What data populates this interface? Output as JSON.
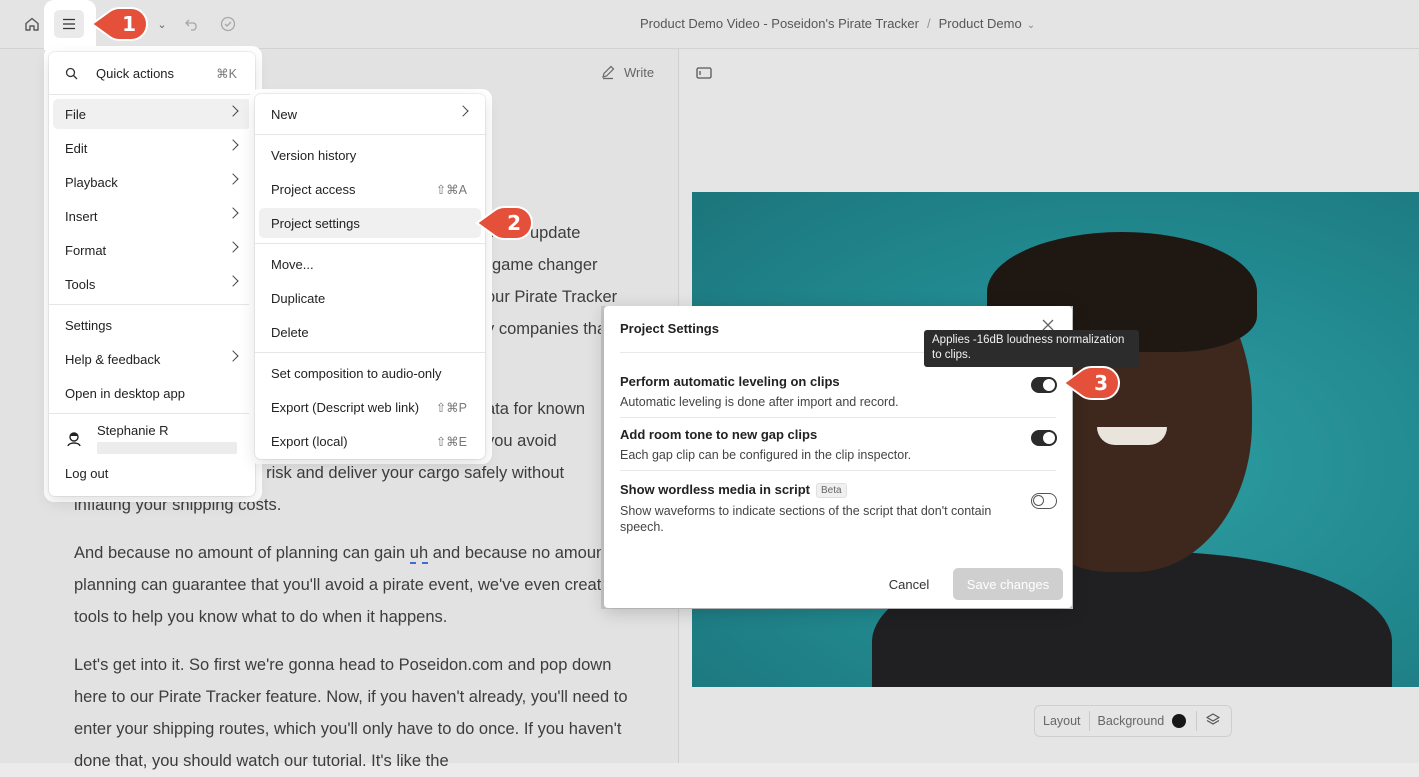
{
  "header": {
    "project_name": "Product Demo Video - Poseidon's Pirate Tracker",
    "separator": "/",
    "composition_name": "Product Demo",
    "write_label": "Write"
  },
  "script": {
    "frag_1": "ec an update",
    "frag_2": "game changer",
    "frag_3": "our Pirate Tracker",
    "frag_4": "y companies tha",
    "frag_5": "ata for known",
    "frag_6": "you avoid",
    "frag_7": "r risk and deliver your cargo safely without",
    "frag_8": "inflating your shipping costs.",
    "para_2_a": "And because no amount of planning can gain ",
    "para_2_uh": "uh",
    "para_2_b": " and because no amount of planning can guarantee that you'll avoid a pirate event, we've even created tools to help you know what to do when it happens.",
    "para_3": "Let's get into it. So first we're gonna head to Poseidon.com and pop down here to our Pirate Tracker feature. Now, if you haven't already, you'll need to enter your shipping routes, which you'll only have to do once. If you haven't done that, you should watch our tutorial. It's like the"
  },
  "main_menu": {
    "quick_actions": "Quick actions",
    "quick_actions_shortcut": "⌘K",
    "items": [
      "File",
      "Edit",
      "Playback",
      "Insert",
      "Format",
      "Tools"
    ],
    "settings": "Settings",
    "help": "Help & feedback",
    "desktop": "Open in desktop app",
    "user_name": "Stephanie R",
    "logout": "Log out"
  },
  "file_menu": {
    "new": "New",
    "version_history": "Version history",
    "project_access": "Project access",
    "project_access_shortcut": "⇧⌘A",
    "project_settings": "Project settings",
    "move": "Move...",
    "duplicate": "Duplicate",
    "delete": "Delete",
    "audio_only": "Set composition to audio-only",
    "export_web": "Export (Descript web link)",
    "export_web_shortcut": "⇧⌘P",
    "export_local": "Export (local)",
    "export_local_shortcut": "⇧⌘E"
  },
  "dialog": {
    "title": "Project Settings",
    "options": [
      {
        "title": "Perform automatic leveling on clips",
        "desc": "Automatic leveling is done after import and record.",
        "on": true
      },
      {
        "title": "Add room tone to new gap clips",
        "desc": "Each gap clip can be configured in the clip inspector.",
        "on": true
      },
      {
        "title": "Show wordless media in script",
        "badge": "Beta",
        "desc": "Show waveforms to indicate sections of the script that don't contain speech.",
        "on": false
      }
    ],
    "cancel": "Cancel",
    "save": "Save changes"
  },
  "tooltip": "Applies -16dB loudness normalization to clips.",
  "layout_bar": {
    "layout": "Layout",
    "background": "Background"
  },
  "steps": [
    "1",
    "2",
    "3"
  ],
  "colors": {
    "badge": "#e5503b",
    "toggle_on": "#2b2b2b",
    "video_bg": "#1f8b92"
  }
}
